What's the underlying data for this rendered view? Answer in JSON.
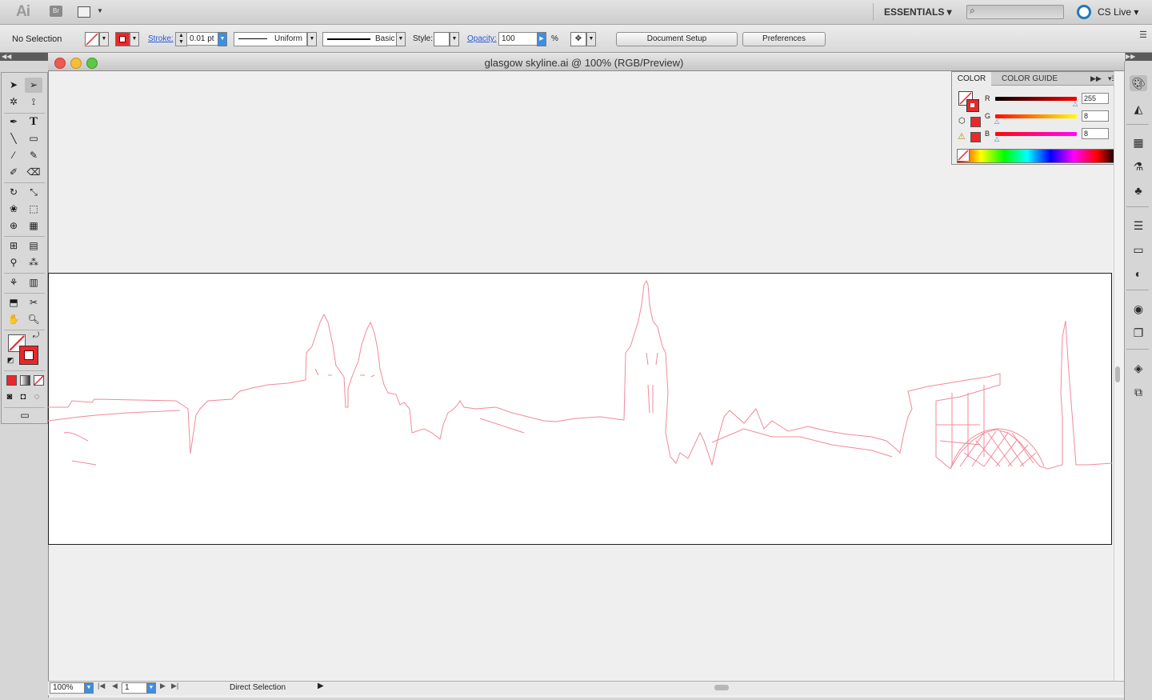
{
  "app": {
    "logo": "Ai",
    "bridge_label": "Br",
    "workspace": "ESSENTIALS ▾",
    "cs_live": "CS Live ▾"
  },
  "control_bar": {
    "selection_status": "No Selection",
    "stroke_label": "Stroke:",
    "stroke_weight": "0.01 pt",
    "variable_width": "Uniform",
    "brush": "Basic",
    "style_label": "Style:",
    "opacity_label": "Opacity:",
    "opacity_value": "100",
    "opacity_unit": "%",
    "document_setup": "Document Setup",
    "preferences": "Preferences"
  },
  "document": {
    "title": "glasgow skyline.ai @ 100% (RGB/Preview)",
    "zoom": "100%",
    "artboard_number": "1",
    "status_tool": "Direct Selection"
  },
  "color_panel": {
    "tab_color": "COLOR",
    "tab_color_guide": "COLOR GUIDE",
    "channels": [
      {
        "label": "R",
        "value": "255"
      },
      {
        "label": "G",
        "value": "8"
      },
      {
        "label": "B",
        "value": "8"
      }
    ],
    "fill_color": "#ffffff",
    "stroke_color": "#ff0808"
  },
  "colors": {
    "accent": "#2a5ad6",
    "stroke_red": "#e8282a",
    "skyline": "#f08a9a"
  }
}
